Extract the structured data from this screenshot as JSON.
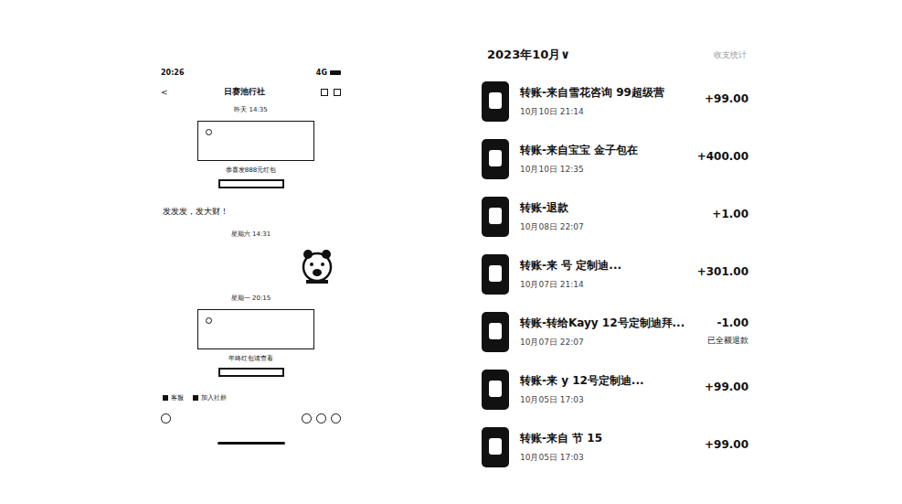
{
  "chat": {
    "status_time": "20:26",
    "status_signal": "4G",
    "back": "<",
    "title": "日赛池行社",
    "messages": [
      {
        "kind": "time",
        "text": "昨天 14:35"
      },
      {
        "kind": "packet",
        "text": "恭喜发888元红包"
      },
      {
        "kind": "text",
        "text": "发发发，发大财！"
      },
      {
        "kind": "time",
        "text": "星期六 14:31"
      },
      {
        "kind": "sticker",
        "text": ""
      },
      {
        "kind": "time",
        "text": "星期一 20:15"
      },
      {
        "kind": "packet",
        "text": "年终红包请查看"
      }
    ],
    "actions": [
      "客服",
      "加入社群"
    ]
  },
  "bills": {
    "month": "2023年10月",
    "month_arrow": "∨",
    "summary": "收支统计",
    "rows": [
      {
        "title": "转账-来自雪花咨询 99超级营",
        "time": "10月10日 21:14",
        "amount": "+99.00",
        "note": ""
      },
      {
        "title": "转账-来自宝宝 金子包在",
        "time": "10月10日 12:35",
        "amount": "+400.00",
        "note": ""
      },
      {
        "title": "转账-退款",
        "time": "10月08日 22:07",
        "amount": "+1.00",
        "note": ""
      },
      {
        "title": "转账-来 号 定制迪...",
        "time": "10月07日 21:14",
        "amount": "+301.00",
        "note": ""
      },
      {
        "title": "转账-转给Kayy 12号定制迪拜...",
        "time": "10月07日 22:07",
        "amount": "-1.00",
        "note": "已全额退款"
      },
      {
        "title": "转账-来 y 12号定制迪...",
        "time": "10月05日 17:03",
        "amount": "+99.00",
        "note": ""
      },
      {
        "title": "转账-来自 节 15",
        "time": "10月05日 17:03",
        "amount": "+99.00",
        "note": ""
      }
    ]
  }
}
